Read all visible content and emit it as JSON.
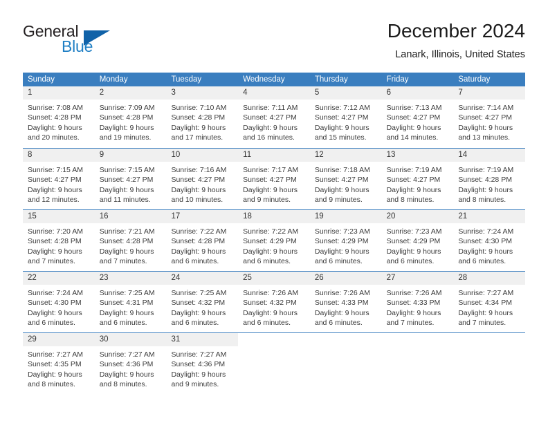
{
  "brand": {
    "name_part1": "General",
    "name_part2": "Blue",
    "logo_icon": "triangle-flag-icon"
  },
  "header": {
    "title": "December 2024",
    "subtitle": "Lanark, Illinois, United States"
  },
  "colors": {
    "header_blue": "#3a7ebf",
    "brand_blue": "#1f7fc4",
    "logo_blue": "#1062a8",
    "day_number_bg": "#f0f0f0",
    "text": "#3a3a3a"
  },
  "weekdays": [
    "Sunday",
    "Monday",
    "Tuesday",
    "Wednesday",
    "Thursday",
    "Friday",
    "Saturday"
  ],
  "weeks": [
    [
      {
        "day": "1",
        "sunrise": "Sunrise: 7:08 AM",
        "sunset": "Sunset: 4:28 PM",
        "daylight1": "Daylight: 9 hours",
        "daylight2": "and 20 minutes."
      },
      {
        "day": "2",
        "sunrise": "Sunrise: 7:09 AM",
        "sunset": "Sunset: 4:28 PM",
        "daylight1": "Daylight: 9 hours",
        "daylight2": "and 19 minutes."
      },
      {
        "day": "3",
        "sunrise": "Sunrise: 7:10 AM",
        "sunset": "Sunset: 4:28 PM",
        "daylight1": "Daylight: 9 hours",
        "daylight2": "and 17 minutes."
      },
      {
        "day": "4",
        "sunrise": "Sunrise: 7:11 AM",
        "sunset": "Sunset: 4:27 PM",
        "daylight1": "Daylight: 9 hours",
        "daylight2": "and 16 minutes."
      },
      {
        "day": "5",
        "sunrise": "Sunrise: 7:12 AM",
        "sunset": "Sunset: 4:27 PM",
        "daylight1": "Daylight: 9 hours",
        "daylight2": "and 15 minutes."
      },
      {
        "day": "6",
        "sunrise": "Sunrise: 7:13 AM",
        "sunset": "Sunset: 4:27 PM",
        "daylight1": "Daylight: 9 hours",
        "daylight2": "and 14 minutes."
      },
      {
        "day": "7",
        "sunrise": "Sunrise: 7:14 AM",
        "sunset": "Sunset: 4:27 PM",
        "daylight1": "Daylight: 9 hours",
        "daylight2": "and 13 minutes."
      }
    ],
    [
      {
        "day": "8",
        "sunrise": "Sunrise: 7:15 AM",
        "sunset": "Sunset: 4:27 PM",
        "daylight1": "Daylight: 9 hours",
        "daylight2": "and 12 minutes."
      },
      {
        "day": "9",
        "sunrise": "Sunrise: 7:15 AM",
        "sunset": "Sunset: 4:27 PM",
        "daylight1": "Daylight: 9 hours",
        "daylight2": "and 11 minutes."
      },
      {
        "day": "10",
        "sunrise": "Sunrise: 7:16 AM",
        "sunset": "Sunset: 4:27 PM",
        "daylight1": "Daylight: 9 hours",
        "daylight2": "and 10 minutes."
      },
      {
        "day": "11",
        "sunrise": "Sunrise: 7:17 AM",
        "sunset": "Sunset: 4:27 PM",
        "daylight1": "Daylight: 9 hours",
        "daylight2": "and 9 minutes."
      },
      {
        "day": "12",
        "sunrise": "Sunrise: 7:18 AM",
        "sunset": "Sunset: 4:27 PM",
        "daylight1": "Daylight: 9 hours",
        "daylight2": "and 9 minutes."
      },
      {
        "day": "13",
        "sunrise": "Sunrise: 7:19 AM",
        "sunset": "Sunset: 4:27 PM",
        "daylight1": "Daylight: 9 hours",
        "daylight2": "and 8 minutes."
      },
      {
        "day": "14",
        "sunrise": "Sunrise: 7:19 AM",
        "sunset": "Sunset: 4:28 PM",
        "daylight1": "Daylight: 9 hours",
        "daylight2": "and 8 minutes."
      }
    ],
    [
      {
        "day": "15",
        "sunrise": "Sunrise: 7:20 AM",
        "sunset": "Sunset: 4:28 PM",
        "daylight1": "Daylight: 9 hours",
        "daylight2": "and 7 minutes."
      },
      {
        "day": "16",
        "sunrise": "Sunrise: 7:21 AM",
        "sunset": "Sunset: 4:28 PM",
        "daylight1": "Daylight: 9 hours",
        "daylight2": "and 7 minutes."
      },
      {
        "day": "17",
        "sunrise": "Sunrise: 7:22 AM",
        "sunset": "Sunset: 4:28 PM",
        "daylight1": "Daylight: 9 hours",
        "daylight2": "and 6 minutes."
      },
      {
        "day": "18",
        "sunrise": "Sunrise: 7:22 AM",
        "sunset": "Sunset: 4:29 PM",
        "daylight1": "Daylight: 9 hours",
        "daylight2": "and 6 minutes."
      },
      {
        "day": "19",
        "sunrise": "Sunrise: 7:23 AM",
        "sunset": "Sunset: 4:29 PM",
        "daylight1": "Daylight: 9 hours",
        "daylight2": "and 6 minutes."
      },
      {
        "day": "20",
        "sunrise": "Sunrise: 7:23 AM",
        "sunset": "Sunset: 4:29 PM",
        "daylight1": "Daylight: 9 hours",
        "daylight2": "and 6 minutes."
      },
      {
        "day": "21",
        "sunrise": "Sunrise: 7:24 AM",
        "sunset": "Sunset: 4:30 PM",
        "daylight1": "Daylight: 9 hours",
        "daylight2": "and 6 minutes."
      }
    ],
    [
      {
        "day": "22",
        "sunrise": "Sunrise: 7:24 AM",
        "sunset": "Sunset: 4:30 PM",
        "daylight1": "Daylight: 9 hours",
        "daylight2": "and 6 minutes."
      },
      {
        "day": "23",
        "sunrise": "Sunrise: 7:25 AM",
        "sunset": "Sunset: 4:31 PM",
        "daylight1": "Daylight: 9 hours",
        "daylight2": "and 6 minutes."
      },
      {
        "day": "24",
        "sunrise": "Sunrise: 7:25 AM",
        "sunset": "Sunset: 4:32 PM",
        "daylight1": "Daylight: 9 hours",
        "daylight2": "and 6 minutes."
      },
      {
        "day": "25",
        "sunrise": "Sunrise: 7:26 AM",
        "sunset": "Sunset: 4:32 PM",
        "daylight1": "Daylight: 9 hours",
        "daylight2": "and 6 minutes."
      },
      {
        "day": "26",
        "sunrise": "Sunrise: 7:26 AM",
        "sunset": "Sunset: 4:33 PM",
        "daylight1": "Daylight: 9 hours",
        "daylight2": "and 6 minutes."
      },
      {
        "day": "27",
        "sunrise": "Sunrise: 7:26 AM",
        "sunset": "Sunset: 4:33 PM",
        "daylight1": "Daylight: 9 hours",
        "daylight2": "and 7 minutes."
      },
      {
        "day": "28",
        "sunrise": "Sunrise: 7:27 AM",
        "sunset": "Sunset: 4:34 PM",
        "daylight1": "Daylight: 9 hours",
        "daylight2": "and 7 minutes."
      }
    ],
    [
      {
        "day": "29",
        "sunrise": "Sunrise: 7:27 AM",
        "sunset": "Sunset: 4:35 PM",
        "daylight1": "Daylight: 9 hours",
        "daylight2": "and 8 minutes."
      },
      {
        "day": "30",
        "sunrise": "Sunrise: 7:27 AM",
        "sunset": "Sunset: 4:36 PM",
        "daylight1": "Daylight: 9 hours",
        "daylight2": "and 8 minutes."
      },
      {
        "day": "31",
        "sunrise": "Sunrise: 7:27 AM",
        "sunset": "Sunset: 4:36 PM",
        "daylight1": "Daylight: 9 hours",
        "daylight2": "and 9 minutes."
      },
      {
        "day": "",
        "sunrise": "",
        "sunset": "",
        "daylight1": "",
        "daylight2": ""
      },
      {
        "day": "",
        "sunrise": "",
        "sunset": "",
        "daylight1": "",
        "daylight2": ""
      },
      {
        "day": "",
        "sunrise": "",
        "sunset": "",
        "daylight1": "",
        "daylight2": ""
      },
      {
        "day": "",
        "sunrise": "",
        "sunset": "",
        "daylight1": "",
        "daylight2": ""
      }
    ]
  ]
}
